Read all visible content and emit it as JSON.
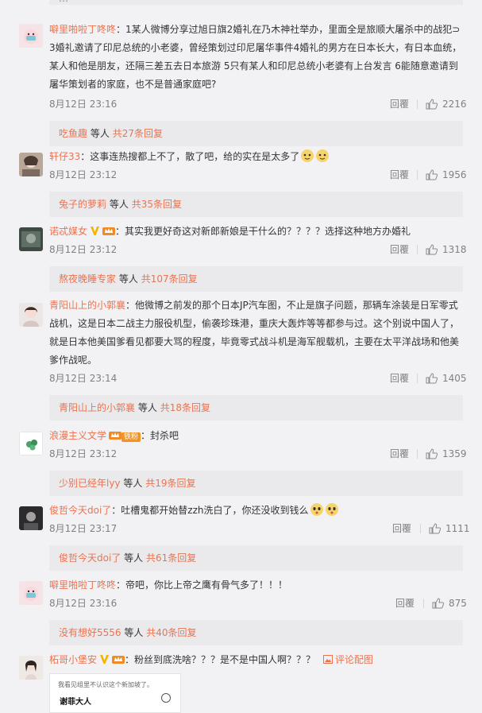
{
  "top_fragment": "…",
  "ui": {
    "reply_label": "回覆",
    "suffix_others": "等人",
    "view_pics": "评论配图"
  },
  "comments": [
    {
      "user": "噼里啪啦丁咚咚",
      "text": "：1某人微博分享过旭日旗2婚礼在乃木神社举办，里面全是旅顺大屠杀中的战犯⊃3婚礼邀请了印尼总统的小老婆，曾经策划过印尼屠华事件4婚礼的男方在日本长大，有日本血统，某人和他是朋友，还隔三差五去日本旅游 5只有某人和印尼总统小老婆有上台发言 6能随意邀请到屠华策划者的家庭，也不是普通家庭吧?",
      "time": "8月12日 23:16",
      "likes": "2216",
      "reply_user": "吃鱼趣",
      "reply_count": "共27条回复"
    },
    {
      "user": "轩仔33",
      "text": "：这事连热搜都上不了，散了吧，给的实在是太多了",
      "time": "8月12日 23:12",
      "likes": "1956",
      "reply_user": "兔子的萝莉",
      "reply_count": "共35条回复"
    },
    {
      "user": "诺忒媒女",
      "text": "：其实我更好奇这对新郎新娘是干什么的？？？？选择这种地方办婚礼",
      "time": "8月12日 23:12",
      "likes": "1318",
      "reply_user": "熬夜晚睡专家",
      "reply_count": "共107条回复"
    },
    {
      "user": "青阳山上的小郭襄",
      "text": "：他微博之前发的那个日本JP汽车图，不止是旗子问题，那辆车涂装是日军零式战机，这是日本二战主力服役机型，偷袭珍珠港，重庆大轰炸等等都参与过。这个别说中国人了，就是日本他美国爹看见都要大骂的程度，毕竟零式战斗机是海军舰载机，主要在太平洋战场和他美爹作战呢。",
      "time": "8月12日 23:14",
      "likes": "1405",
      "reply_user": "青阳山上的小郭襄",
      "reply_count": "共18条回复"
    },
    {
      "user": "浪漫主义文学",
      "tag": "铁粉",
      "text": "：封杀吧",
      "time": "8月12日 23:12",
      "likes": "1359",
      "reply_user": "少别已经年lyy",
      "reply_count": "共19条回复"
    },
    {
      "user": "俊哲今天doi了",
      "text": "：吐槽鬼都开始替zzh洗白了，你还没收到钱么",
      "time": "8月12日 23:17",
      "likes": "1111",
      "reply_user": "俊哲今天doi了",
      "reply_count": "共61条回复"
    },
    {
      "user": "噼里啪啦丁咚咚",
      "text": "：帝吧，你比上帝之鹰有骨气多了！！！",
      "time": "8月12日 23:16",
      "likes": "875",
      "reply_user": "没有想好5556",
      "reply_count": "共40条回复"
    },
    {
      "user": "柘哥小堡安",
      "text": "：粉丝到底洗啥？？？是不是中国人啊？？？"
    }
  ],
  "thumbnail": {
    "line1": "我看见组里不认识这个新加坡了。",
    "line2": "谢菲大人"
  }
}
